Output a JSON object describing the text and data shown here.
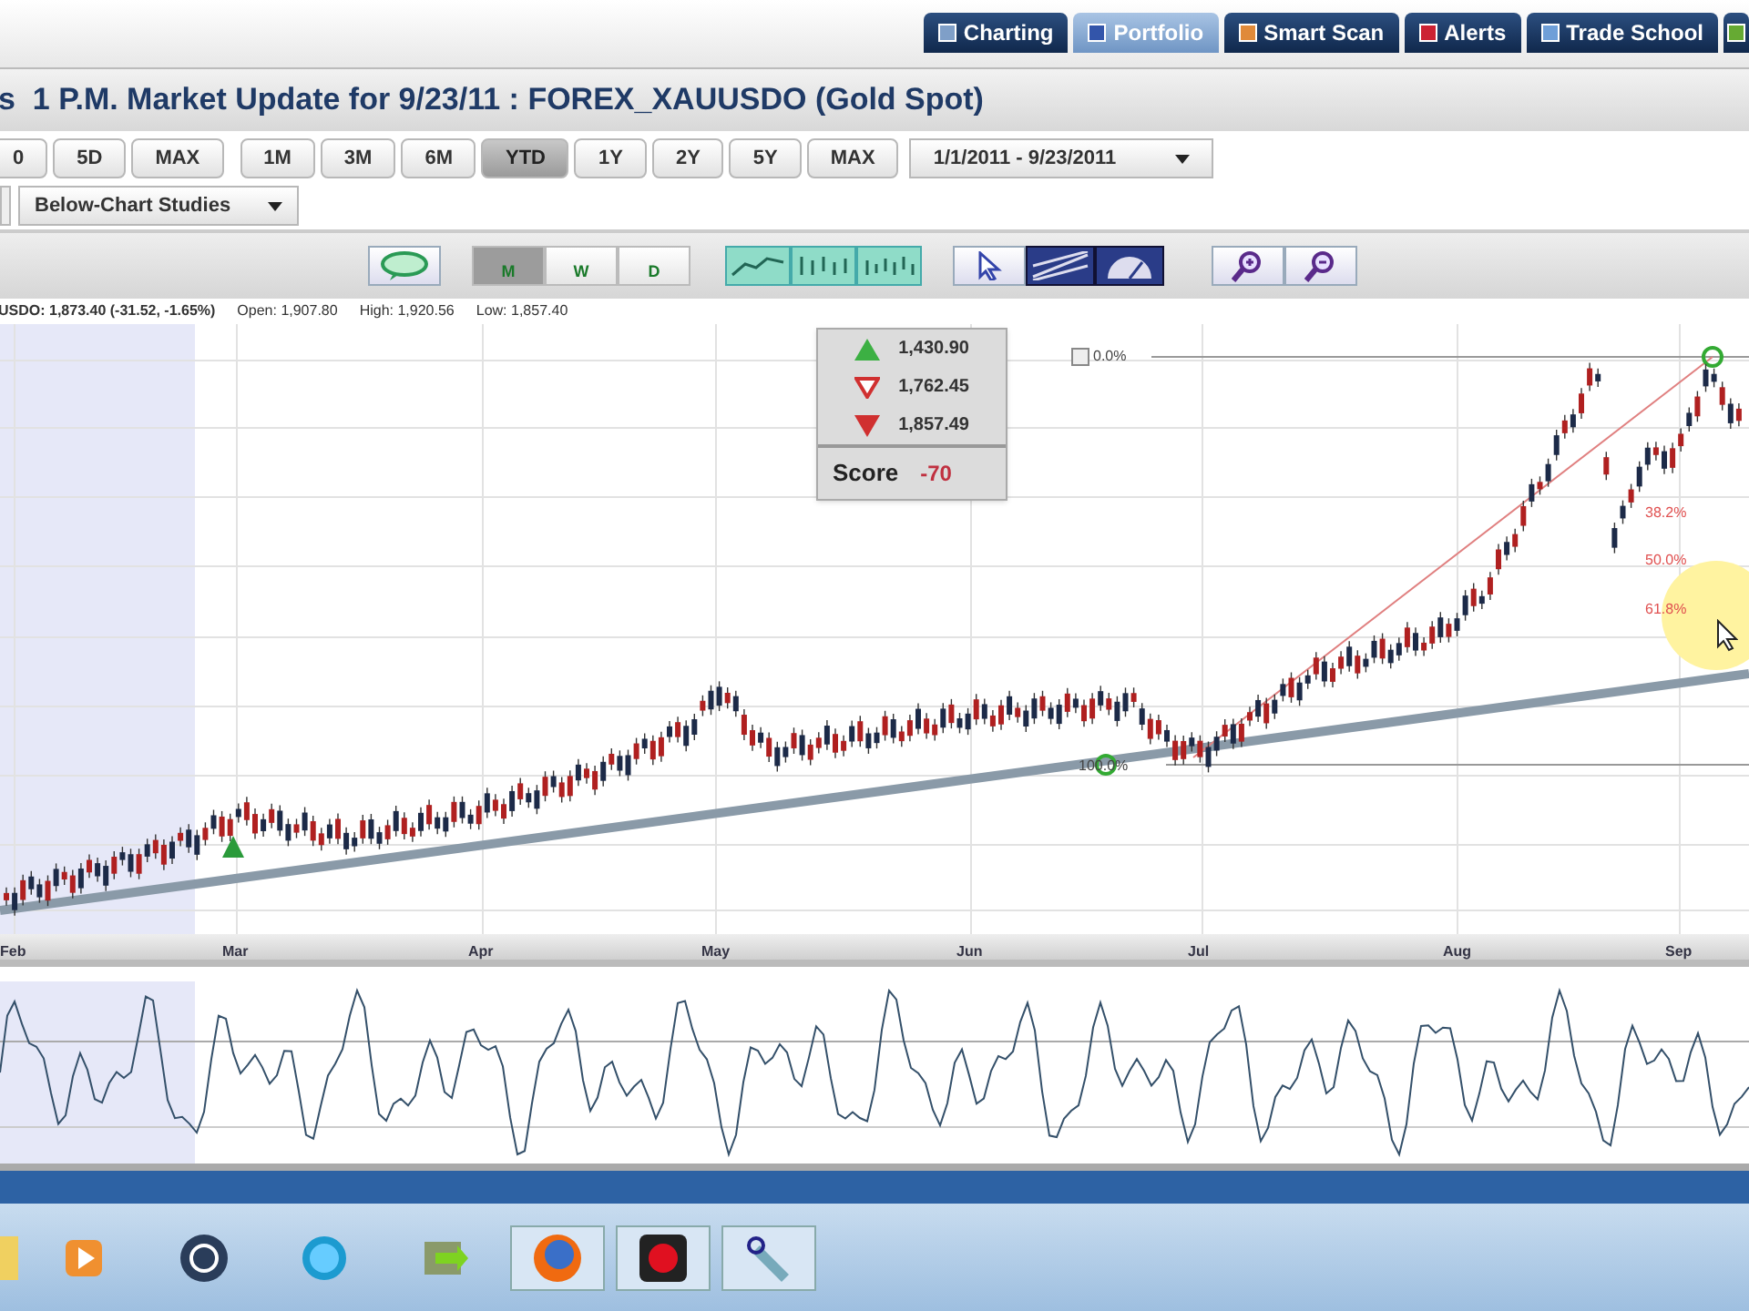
{
  "nav_tabs": [
    {
      "label": "Charting",
      "selected": false,
      "color": "#7f9fc8"
    },
    {
      "label": "Portfolio",
      "selected": true,
      "color": "#3355aa"
    },
    {
      "label": "Smart Scan",
      "selected": false,
      "color": "#e08a3a"
    },
    {
      "label": "Alerts",
      "selected": false,
      "color": "#cc2233"
    },
    {
      "label": "Trade School",
      "selected": false,
      "color": "#6f9fd8"
    },
    {
      "selected": false,
      "color": "#66aa33"
    }
  ],
  "title": "s  1 P.M. Market Update for 9/23/11 : FOREX_XAUUSDO (Gold Spot)",
  "periods_left": [
    {
      "label": "0",
      "selected": false
    },
    {
      "label": "5D",
      "selected": false
    },
    {
      "label": "MAX",
      "selected": false
    }
  ],
  "periods": [
    {
      "label": "1M",
      "selected": false
    },
    {
      "label": "3M",
      "selected": false
    },
    {
      "label": "6M",
      "selected": false
    },
    {
      "label": "YTD",
      "selected": true
    },
    {
      "label": "1Y",
      "selected": false
    },
    {
      "label": "2Y",
      "selected": false
    },
    {
      "label": "5Y",
      "selected": false
    },
    {
      "label": "MAX",
      "selected": false
    }
  ],
  "date_range": "1/1/2011 - 9/23/2011",
  "studies_dropdown": "Below-Chart Studies",
  "intervals": [
    {
      "label": "M",
      "selected": true
    },
    {
      "label": "W",
      "selected": false
    },
    {
      "label": "D",
      "selected": false
    }
  ],
  "quote": {
    "symbol": "USDO: 1,873.40 (-31.52, -1.65%)",
    "open": "Open: 1,907.80",
    "high": "High: 1,920.56",
    "low": "Low: 1,857.40"
  },
  "signals": [
    {
      "kind": "up",
      "value": "1,430.90"
    },
    {
      "kind": "down-outline",
      "value": "1,762.45"
    },
    {
      "kind": "down",
      "value": "1,857.49"
    }
  ],
  "score": {
    "label": "Score",
    "value": "-70"
  },
  "fib_checkbox": {
    "checked": false
  },
  "fib_levels": [
    {
      "label": "0.0%",
      "kind": "top"
    },
    {
      "label": "38.2%",
      "kind": "mid"
    },
    {
      "label": "50.0%",
      "kind": "mid"
    },
    {
      "label": "61.8%",
      "kind": "mid"
    },
    {
      "label": "100.0%",
      "kind": "bottom"
    }
  ],
  "months": [
    "Feb",
    "Mar",
    "Apr",
    "May",
    "Jun",
    "Jul",
    "Aug",
    "Sep"
  ]
}
